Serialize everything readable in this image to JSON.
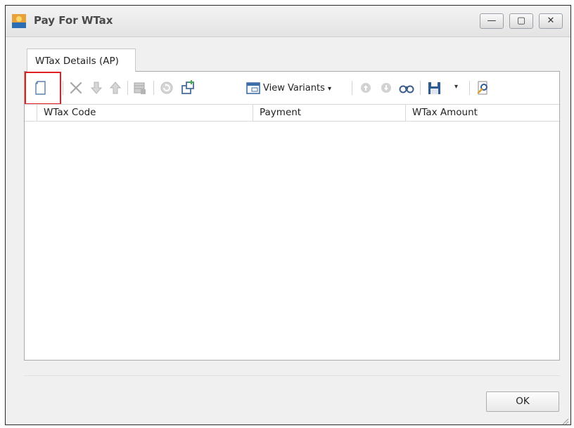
{
  "window": {
    "title": "Pay For WTax",
    "minimize_symbol": "—",
    "maximize_symbol": "▢",
    "close_symbol": "✕"
  },
  "tab": {
    "label": "WTax Details (AP)"
  },
  "toolbar": {
    "view_variants_label": "View Variants",
    "view_variants_arrow": "▾",
    "save_arrow": "▾",
    "icons": [
      "new-row-icon",
      "delete-icon",
      "move-down-icon",
      "move-up-icon",
      "grid-options-icon",
      "refresh-icon",
      "duplicate-icon",
      "view-variants-icon",
      "prev-icon",
      "next-icon",
      "binoculars-icon",
      "save-icon",
      "search-icon"
    ]
  },
  "grid": {
    "columns": [
      "WTax Code",
      "Payment",
      "WTax Amount"
    ],
    "rows": []
  },
  "footer": {
    "ok_label": "OK"
  },
  "colors": {
    "highlight": "#e02020",
    "window_bg": "#f0f0f0",
    "border": "#a9a9a9"
  }
}
